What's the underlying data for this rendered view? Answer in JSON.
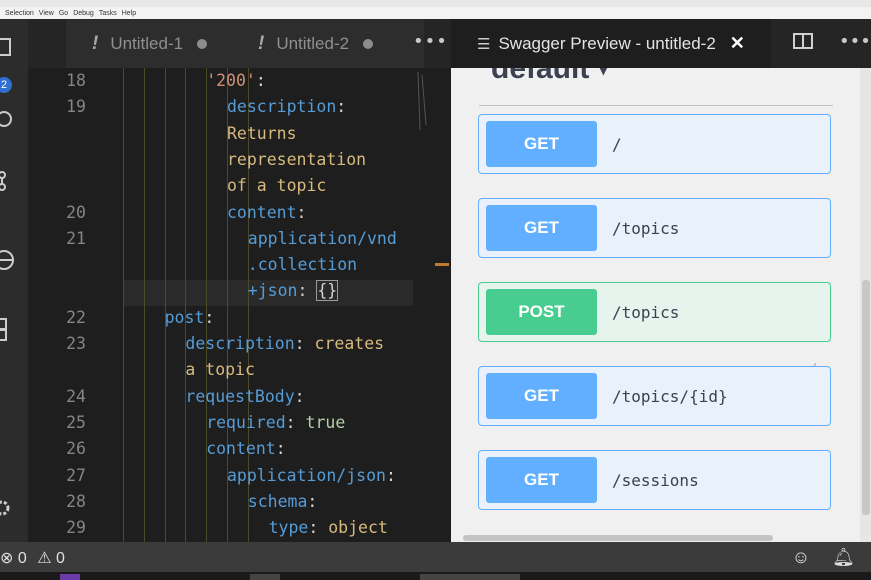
{
  "menu": [
    "Selection",
    "View",
    "Go",
    "Debug",
    "Tasks",
    "Help"
  ],
  "activity": {
    "badge": "2"
  },
  "editor_tabs": [
    {
      "label": "Untitled-1",
      "modified_glyph": "!"
    },
    {
      "label": "Untitled-2",
      "modified_glyph": "!"
    }
  ],
  "more_glyph": "•••",
  "code_lines": [
    {
      "num": "18",
      "indent": 4,
      "tokens": [
        {
          "t": "'200'",
          "c": "s"
        },
        {
          "t": ":",
          "c": "w"
        }
      ]
    },
    {
      "num": "19",
      "indent": 5,
      "tokens": [
        {
          "t": "description",
          "c": "k"
        },
        {
          "t": ": ",
          "c": "w"
        }
      ]
    },
    {
      "num": "",
      "indent": 5,
      "tokens": [
        {
          "t": "Returns",
          "c": "y"
        }
      ]
    },
    {
      "num": "",
      "indent": 5,
      "tokens": [
        {
          "t": "representation",
          "c": "y"
        }
      ]
    },
    {
      "num": "",
      "indent": 5,
      "tokens": [
        {
          "t": "of a topic",
          "c": "y"
        }
      ]
    },
    {
      "num": "20",
      "indent": 5,
      "tokens": [
        {
          "t": "content",
          "c": "k"
        },
        {
          "t": ":",
          "c": "w"
        }
      ]
    },
    {
      "num": "21",
      "indent": 6,
      "tokens": [
        {
          "t": "application/vnd",
          "c": "k"
        }
      ]
    },
    {
      "num": "",
      "indent": 6,
      "tokens": [
        {
          "t": ".collection",
          "c": "k"
        }
      ]
    },
    {
      "num": "",
      "indent": 6,
      "tokens": [
        {
          "t": "+json",
          "c": "k"
        },
        {
          "t": ": ",
          "c": "w"
        },
        {
          "t": "{}",
          "c": "w",
          "box": true
        }
      ]
    },
    {
      "num": "22",
      "indent": 2,
      "tokens": [
        {
          "t": "post",
          "c": "k"
        },
        {
          "t": ":",
          "c": "w"
        }
      ]
    },
    {
      "num": "23",
      "indent": 3,
      "tokens": [
        {
          "t": "description",
          "c": "k"
        },
        {
          "t": ": ",
          "c": "w"
        },
        {
          "t": "creates",
          "c": "y"
        }
      ]
    },
    {
      "num": "",
      "indent": 3,
      "tokens": [
        {
          "t": "a topic",
          "c": "y"
        }
      ]
    },
    {
      "num": "24",
      "indent": 3,
      "tokens": [
        {
          "t": "requestBody",
          "c": "k"
        },
        {
          "t": ":",
          "c": "w"
        }
      ]
    },
    {
      "num": "25",
      "indent": 4,
      "tokens": [
        {
          "t": "required",
          "c": "k"
        },
        {
          "t": ": ",
          "c": "w"
        },
        {
          "t": "true",
          "c": "g"
        }
      ]
    },
    {
      "num": "26",
      "indent": 4,
      "tokens": [
        {
          "t": "content",
          "c": "k"
        },
        {
          "t": ":",
          "c": "w"
        }
      ]
    },
    {
      "num": "27",
      "indent": 5,
      "tokens": [
        {
          "t": "application/json",
          "c": "k"
        },
        {
          "t": ":",
          "c": "w"
        }
      ]
    },
    {
      "num": "28",
      "indent": 6,
      "tokens": [
        {
          "t": "schema",
          "c": "k"
        },
        {
          "t": ":",
          "c": "w"
        }
      ]
    },
    {
      "num": "29",
      "indent": 7,
      "tokens": [
        {
          "t": "type",
          "c": "k"
        },
        {
          "t": ": ",
          "c": "w"
        },
        {
          "t": "object",
          "c": "y"
        }
      ]
    }
  ],
  "preview_tab": {
    "label": "Swagger Preview - untitled-2",
    "close": "✕"
  },
  "swagger": {
    "section_title": "default",
    "operations": [
      {
        "method": "GET",
        "path": "/"
      },
      {
        "method": "GET",
        "path": "/topics"
      },
      {
        "method": "POST",
        "path": "/topics"
      },
      {
        "method": "GET",
        "path": "/topics/{id}"
      },
      {
        "method": "GET",
        "path": "/sessions"
      }
    ]
  },
  "status": {
    "errors": "0",
    "warnings": "0",
    "error_glyph": "⊗",
    "warning_glyph": "⚠"
  }
}
